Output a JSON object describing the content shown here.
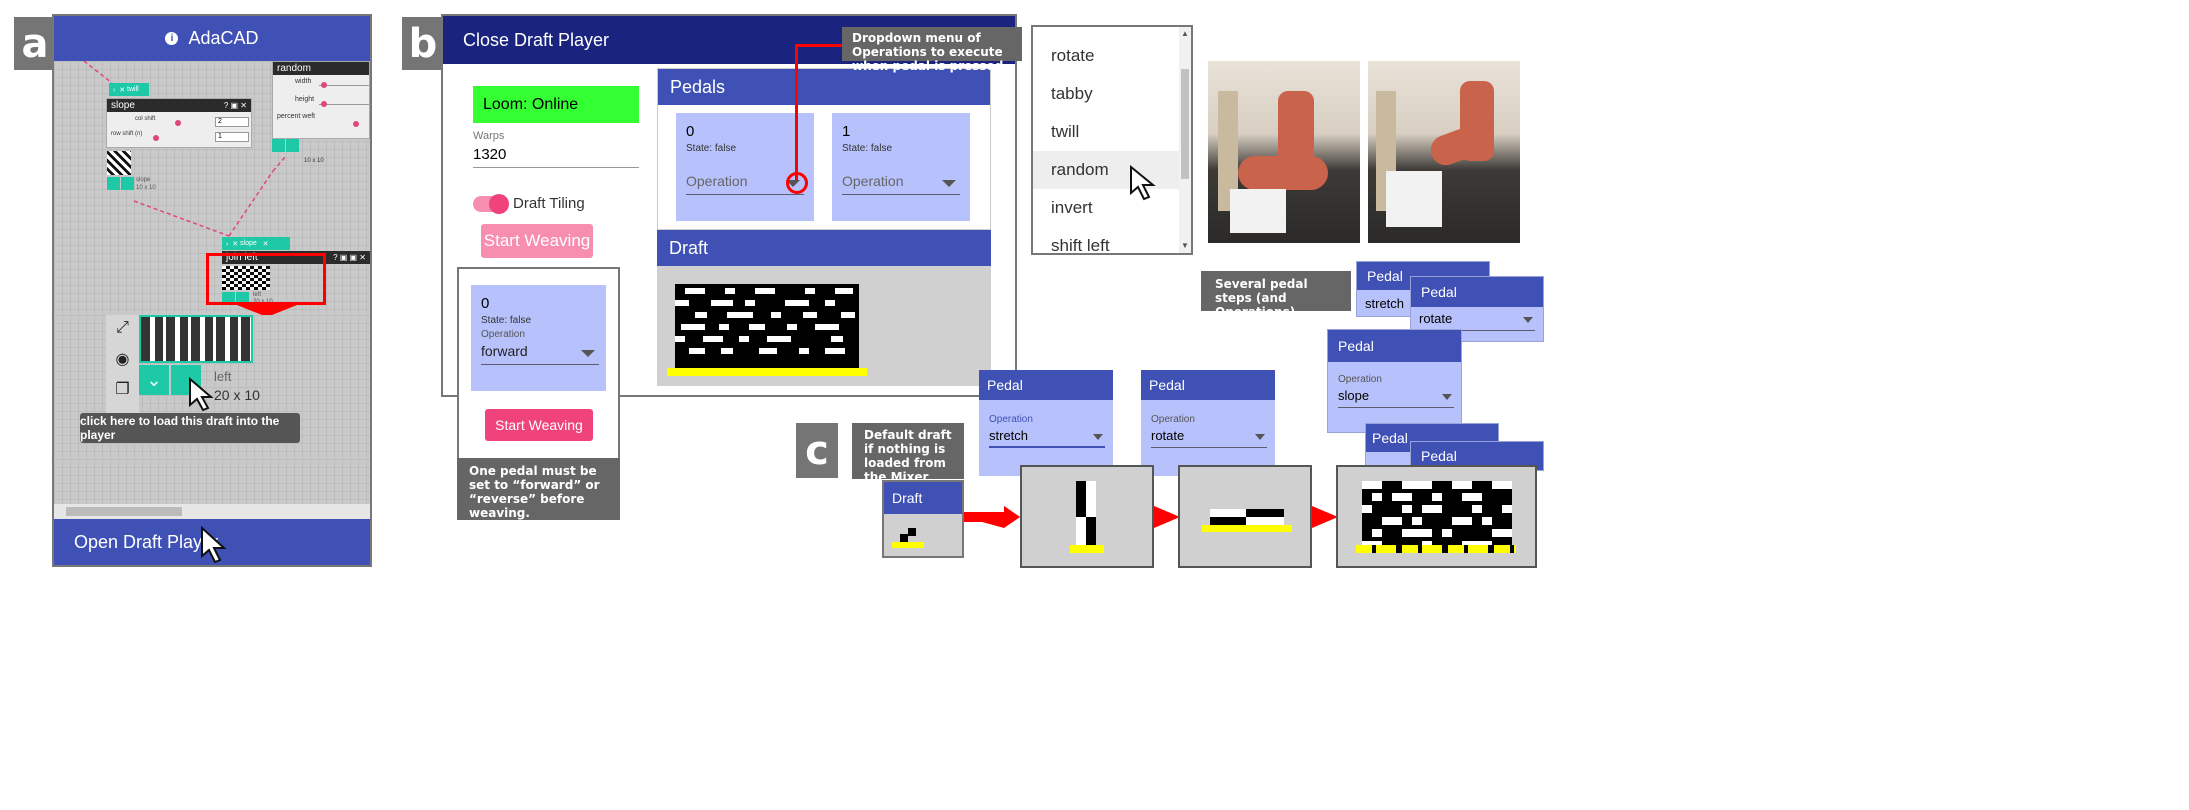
{
  "panel_a": {
    "letter": "a",
    "app_title": "AdaCAD",
    "random_node": {
      "title": "random",
      "rows": [
        "width",
        "height",
        "percent weft"
      ],
      "size": "10 x 10"
    },
    "slope_node": {
      "title": "slope",
      "col_shift_label": "col shift",
      "col_shift_value": "2",
      "row_shift_label": "row shift (n)",
      "row_shift_value": "1",
      "size": "10 x 10",
      "small_name": "slope"
    },
    "twill_chip": "twill",
    "slope_chip": "slope",
    "join_node": {
      "title": "join left",
      "size": "20 x 10",
      "small_name": "left"
    },
    "draft_name": "left",
    "draft_size": "20 x 10",
    "tooltip": "click here to load this draft into the player",
    "open_player": "Open Draft Player"
  },
  "panel_b": {
    "letter": "b",
    "header": "Close Draft Player",
    "callout": "Dropdown menu of Operations to execute when pedal is pressed.",
    "loom_status": "Loom: Online",
    "warps_label": "Warps",
    "warps_value": "1320",
    "draft_tiling": "Draft Tiling",
    "start_weaving": "Start Weaving",
    "pedals_title": "Pedals",
    "pedals": [
      {
        "num": "0",
        "state": "State:  false",
        "operation_placeholder": "Operation"
      },
      {
        "num": "1",
        "state": "State:  false",
        "operation_placeholder": "Operation"
      }
    ],
    "draft_title": "Draft",
    "inset": {
      "num": "0",
      "state": "State:  false",
      "op_label": "Operation",
      "op_value": "forward",
      "start_weaving": "Start Weaving"
    },
    "inset_caption": "One pedal must be set to “forward” or “reverse” before weaving."
  },
  "dropdown": {
    "options": [
      "rotate",
      "tabby",
      "twill",
      "random",
      "invert",
      "shift left"
    ],
    "highlighted": "random"
  },
  "panel_c": {
    "letter": "c",
    "several_caption": "Several pedal steps (and Operations) later...",
    "default_caption": "Default draft if nothing is loaded from the Mixer",
    "draft_title": "Draft",
    "pedal_label": "Pedal",
    "operation_label": "Operation",
    "pedal_cards": [
      {
        "op": "stretch"
      },
      {
        "op": "rotate"
      }
    ],
    "stack": [
      {
        "op": "stretch"
      },
      {
        "op": "rotate"
      },
      {
        "op": "slope"
      }
    ]
  },
  "colors": {
    "indigo": "#3f51b5",
    "navy": "#1a237e",
    "lavender": "#b7c1fb",
    "pink": "#f0437b",
    "teal": "#1ec9a8",
    "green": "#33ff33",
    "red": "#ff0000",
    "yellow": "#ffff00"
  }
}
